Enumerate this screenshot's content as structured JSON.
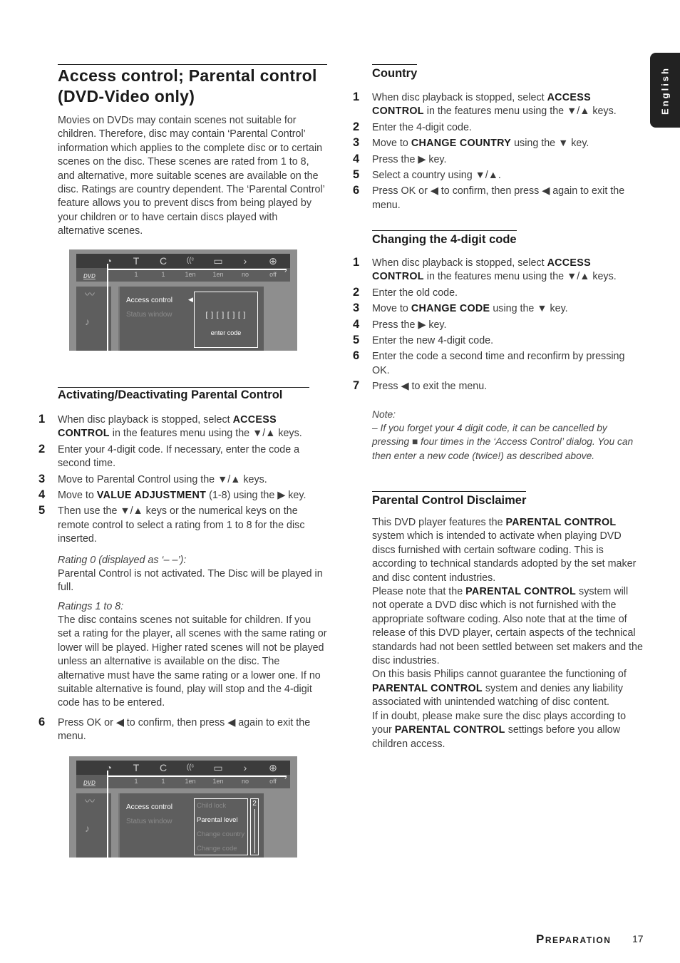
{
  "language_tab": "English",
  "left": {
    "title": "Access control; Parental control (DVD-Video only)",
    "intro": "Movies on DVDs may contain scenes not suitable for children. Therefore, disc may contain ‘Parental Control’ information which applies to the complete disc or to certain scenes on the disc. These scenes are rated from 1 to 8, and alternative, more suitable scenes are available on the disc. Ratings are country dependent. The ‘Parental Control’ feature allows you to prevent discs from being played by your children or to have certain discs played with alternative scenes.",
    "section_heading": "Activating/Deactivating Parental Control",
    "steps": [
      {
        "num": "1",
        "pre": "When disc playback is stopped, select ",
        "bold": "ACCESS CONTROL",
        "post": " in the features menu using the ▼/▲ keys."
      },
      {
        "num": "2",
        "pre": "Enter your 4-digit code. If necessary, enter the code a second time.",
        "bold": "",
        "post": ""
      },
      {
        "num": "3",
        "pre": "Move to Parental Control using the ▼/▲ keys.",
        "bold": "",
        "post": ""
      },
      {
        "num": "4",
        "pre": "Move to ",
        "bold": "VALUE ADJUSTMENT",
        "post": " (1-8) using the ▶ key."
      },
      {
        "num": "5",
        "pre": "Then use the ▼/▲ keys or the numerical keys on the remote control to select a rating from 1 to 8 for the disc inserted.",
        "bold": "",
        "post": ""
      }
    ],
    "rating0_label": "Rating 0 (displayed as ‘– –’):",
    "rating0_text": "Parental Control is not activated. The Disc will be played in full.",
    "ratings18_label": "Ratings 1 to 8:",
    "ratings18_text": "The disc contains scenes not suitable for children. If you set a rating for the player, all scenes with the same rating or lower will be played. Higher rated scenes will not be played unless an alternative is available on the disc. The alternative must have the same rating or a lower one. If no suitable alternative is found, play will stop and the 4-digit code has to be entered.",
    "step6": {
      "num": "6",
      "text": "Press OK or ◀ to confirm, then press ◀ again to exit the menu."
    }
  },
  "osd": {
    "dvd_logo": "DVD",
    "icons": [
      "◔",
      "T",
      "C",
      "((ᶜ",
      "▭",
      "›",
      "⊕"
    ],
    "values": [
      "1",
      "1",
      "1en",
      "1en",
      "no",
      "off"
    ],
    "menu_item_active": "Access control",
    "menu_item_inactive": "Status window",
    "code_entry": "[ ] [ ] [ ] [ ]",
    "code_label": "enter code",
    "sub_items": [
      "Child lock",
      "Parental level",
      "Change country",
      "Change code"
    ],
    "sub_active_index": 1,
    "level_value": "2"
  },
  "right": {
    "country": {
      "heading": "Country",
      "steps": [
        {
          "num": "1",
          "pre": "When disc playback is stopped, select ",
          "bold": "ACCESS CONTROL",
          "post": " in the features menu using the ▼/▲ keys."
        },
        {
          "num": "2",
          "pre": "Enter the 4-digit code.",
          "bold": "",
          "post": ""
        },
        {
          "num": "3",
          "pre": "Move to ",
          "bold": "CHANGE COUNTRY",
          "post": " using the ▼ key."
        },
        {
          "num": "4",
          "pre": "Press the ▶ key.",
          "bold": "",
          "post": ""
        },
        {
          "num": "5",
          "pre": "Select a country using ▼/▲.",
          "bold": "",
          "post": ""
        },
        {
          "num": "6",
          "pre": "Press OK or ◀ to confirm, then press ◀ again to exit the menu.",
          "bold": "",
          "post": ""
        }
      ]
    },
    "change_code": {
      "heading": "Changing the 4-digit code",
      "steps": [
        {
          "num": "1",
          "pre": "When disc playback is stopped, select ",
          "bold": "ACCESS CONTROL",
          "post": " in the features menu using the ▼/▲ keys."
        },
        {
          "num": "2",
          "pre": "Enter the old code.",
          "bold": "",
          "post": ""
        },
        {
          "num": "3",
          "pre": "Move to ",
          "bold": "CHANGE CODE",
          "post": " using the ▼ key."
        },
        {
          "num": "4",
          "pre": "Press the ▶ key.",
          "bold": "",
          "post": ""
        },
        {
          "num": "5",
          "pre": "Enter the new 4-digit code.",
          "bold": "",
          "post": ""
        },
        {
          "num": "6",
          "pre": "Enter the code a second time and reconfirm by pressing OK.",
          "bold": "",
          "post": ""
        },
        {
          "num": "7",
          "pre": "Press ◀ to exit the menu.",
          "bold": "",
          "post": ""
        }
      ],
      "note_label": "Note:",
      "note_text": "–  If you forget your 4 digit code, it can be cancelled by pressing ■ four times in the ‘Access Control’ dialog. You can then enter a new code (twice!) as described above."
    },
    "disclaimer": {
      "heading": "Parental Control Disclaimer",
      "p1_pre": "This DVD player features the ",
      "p1_bold": "PARENTAL CONTROL",
      "p1_post": " system which is intended to activate when playing DVD discs furnished with certain software coding. This is according to technical standards adopted by the set maker and disc content industries.",
      "p2_pre": "Please note that the ",
      "p2_bold": "PARENTAL CONTROL",
      "p2_post": " system will not operate a DVD disc which is not furnished with the appropriate software coding. Also note that at the time of release of this DVD player, certain aspects of the technical standards had not been settled between set makers and the disc industries.",
      "p3_pre": "On this basis Philips cannot guarantee the functioning of ",
      "p3_bold": "PARENTAL CONTROL",
      "p3_post": " system and denies any liability associated with unintended watching of disc content.",
      "p4_pre": "If in doubt, please make sure the disc plays according to your ",
      "p4_bold": "PARENTAL CONTROL",
      "p4_post": " settings before you allow children access."
    }
  },
  "footer": {
    "section": "Preparation",
    "page": "17"
  }
}
